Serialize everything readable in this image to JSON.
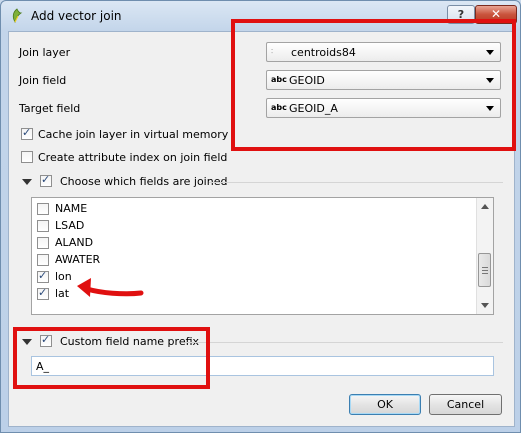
{
  "window": {
    "title": "Add vector join",
    "help_label": "?",
    "close_label": "✕"
  },
  "form": {
    "join_layer_label": "Join layer",
    "join_layer_value": "centroids84",
    "join_field_label": "Join field",
    "join_field_value": "GEOID",
    "target_field_label": "Target field",
    "target_field_value": "GEOID_A",
    "field_type_badge": "abc",
    "cache_label": "Cache join layer in virtual memory",
    "cache_checked": true,
    "index_label": "Create attribute index on join field",
    "index_checked": false
  },
  "fields_group": {
    "title": "Choose which fields are joined",
    "checked": true,
    "items": [
      {
        "label": "NAME",
        "checked": false
      },
      {
        "label": "LSAD",
        "checked": false
      },
      {
        "label": "ALAND",
        "checked": false
      },
      {
        "label": "AWATER",
        "checked": false
      },
      {
        "label": "lon",
        "checked": true
      },
      {
        "label": "lat",
        "checked": true
      }
    ]
  },
  "prefix_group": {
    "title": "Custom field name prefix",
    "checked": true,
    "value": "A_"
  },
  "buttons": {
    "ok": "OK",
    "cancel": "Cancel"
  },
  "colors": {
    "annotation_red": "#e01010",
    "window_frame": "#c3d5ea",
    "client_bg": "#f0f0f0"
  }
}
